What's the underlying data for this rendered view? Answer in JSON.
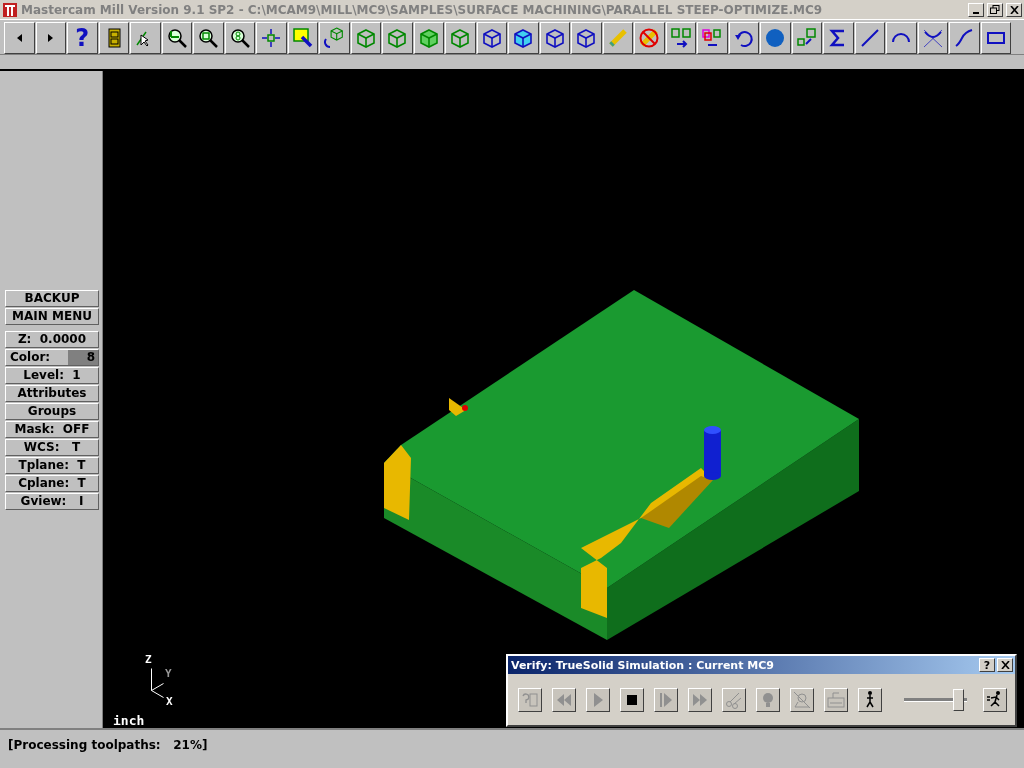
{
  "window": {
    "title": "Mastercam Mill Version 9.1 SP2 - C:\\MCAM9\\MILL\\MC9\\SAMPLES\\SURFACE MACHINING\\PARALLEL STEEP-OPTIMIZE.MC9",
    "active": false
  },
  "toolbar": [
    {
      "kind": "arrow-left"
    },
    {
      "kind": "arrow-right"
    },
    {
      "kind": "help",
      "label": "?"
    },
    {
      "kind": "cabinet"
    },
    {
      "kind": "pointer-help"
    },
    {
      "kind": "zoom-window"
    },
    {
      "kind": "zoom-box"
    },
    {
      "kind": "zoom-8"
    },
    {
      "kind": "pan"
    },
    {
      "kind": "paint"
    },
    {
      "kind": "rotate-cube"
    },
    {
      "kind": "wire-cube"
    },
    {
      "kind": "wire-cube"
    },
    {
      "kind": "shaded-cube"
    },
    {
      "kind": "wire-cube"
    },
    {
      "kind": "blue-cube"
    },
    {
      "kind": "cyan-cube"
    },
    {
      "kind": "blue-cube"
    },
    {
      "kind": "blue-cube"
    },
    {
      "kind": "pencil"
    },
    {
      "kind": "no-pencil"
    },
    {
      "kind": "move"
    },
    {
      "kind": "copy"
    },
    {
      "kind": "undo"
    },
    {
      "kind": "sphere"
    },
    {
      "kind": "scale"
    },
    {
      "kind": "sigma"
    },
    {
      "kind": "line"
    },
    {
      "kind": "arc"
    },
    {
      "kind": "fillet"
    },
    {
      "kind": "spline"
    },
    {
      "kind": "rectangle"
    }
  ],
  "sidebar": {
    "groups": [
      [
        {
          "label": "BACKUP"
        },
        {
          "label": "MAIN MENU"
        }
      ],
      [
        {
          "label": "Z:  0.0000"
        },
        {
          "label": "Color:",
          "value": "8"
        },
        {
          "label": "Level:  1"
        },
        {
          "label": "Attributes"
        },
        {
          "label": "Groups"
        },
        {
          "label": "Mask:  OFF"
        },
        {
          "label": "WCS:   T"
        },
        {
          "label": "Tplane:  T"
        },
        {
          "label": "Cplane:  T"
        },
        {
          "label": "Gview:   I"
        }
      ]
    ]
  },
  "viewport": {
    "axes": {
      "z": "Z",
      "y": "Y",
      "x": "X"
    },
    "units": "inch"
  },
  "verify_dialog": {
    "title": "Verify: TrueSolid Simulation : Current MC9",
    "title_buttons": [
      "?"
    ],
    "controls": [
      {
        "kind": "help-step",
        "disabled": true
      },
      {
        "kind": "rewind",
        "disabled": true
      },
      {
        "kind": "play",
        "disabled": true
      },
      {
        "kind": "stop",
        "disabled": false
      },
      {
        "kind": "step",
        "disabled": true
      },
      {
        "kind": "fast-forward",
        "disabled": true
      },
      {
        "kind": "cut",
        "disabled": true
      },
      {
        "kind": "light",
        "disabled": true
      },
      {
        "kind": "inspect",
        "disabled": true
      },
      {
        "kind": "settings",
        "disabled": true
      },
      {
        "kind": "walk",
        "disabled": false
      },
      {
        "kind": "slider",
        "level": 0.95
      },
      {
        "kind": "run",
        "disabled": false
      }
    ]
  },
  "status_bar": {
    "message": "[Processing toolpaths:   21%]"
  }
}
